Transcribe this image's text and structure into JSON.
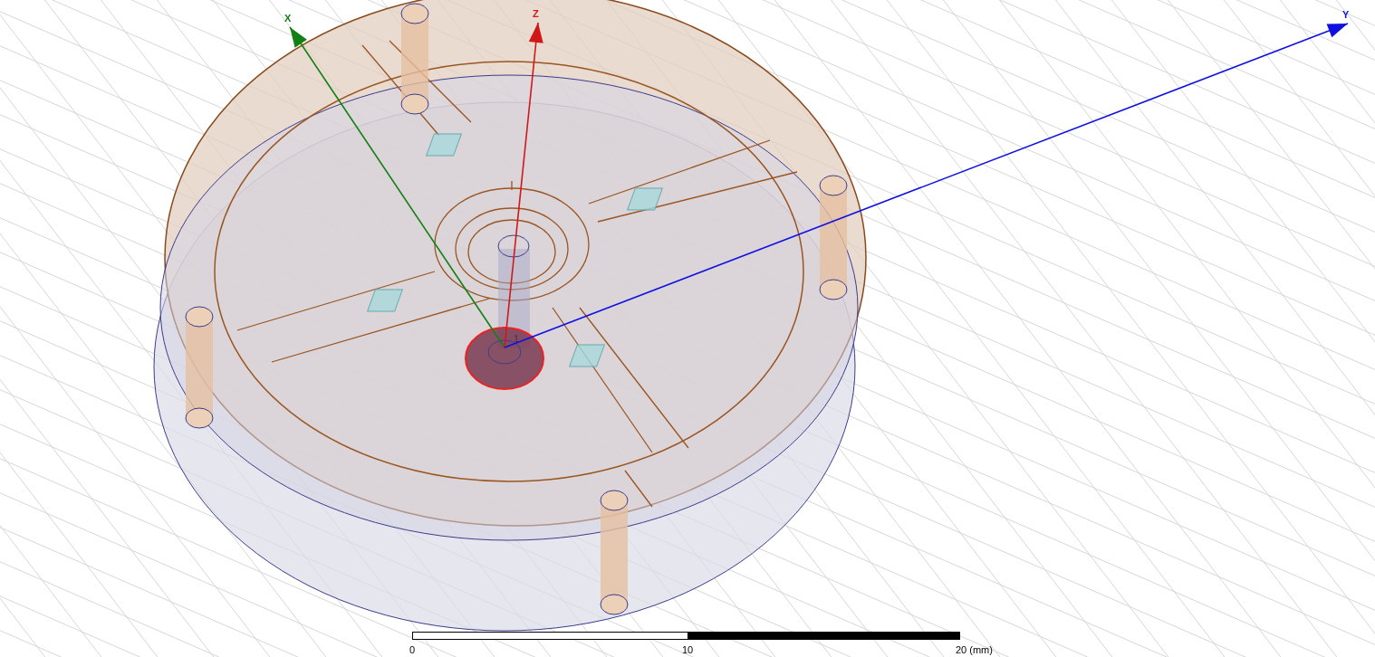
{
  "viewport": {
    "axes": [
      {
        "kind": "x",
        "label": "X",
        "color": "#138013"
      },
      {
        "kind": "z",
        "label": "Z",
        "color": "#d01818"
      },
      {
        "kind": "y",
        "label": "Y",
        "color": "#1010e0"
      }
    ],
    "port_label": "1",
    "scale_bar": {
      "labels": [
        "0",
        "10",
        "20 (mm)"
      ]
    }
  }
}
